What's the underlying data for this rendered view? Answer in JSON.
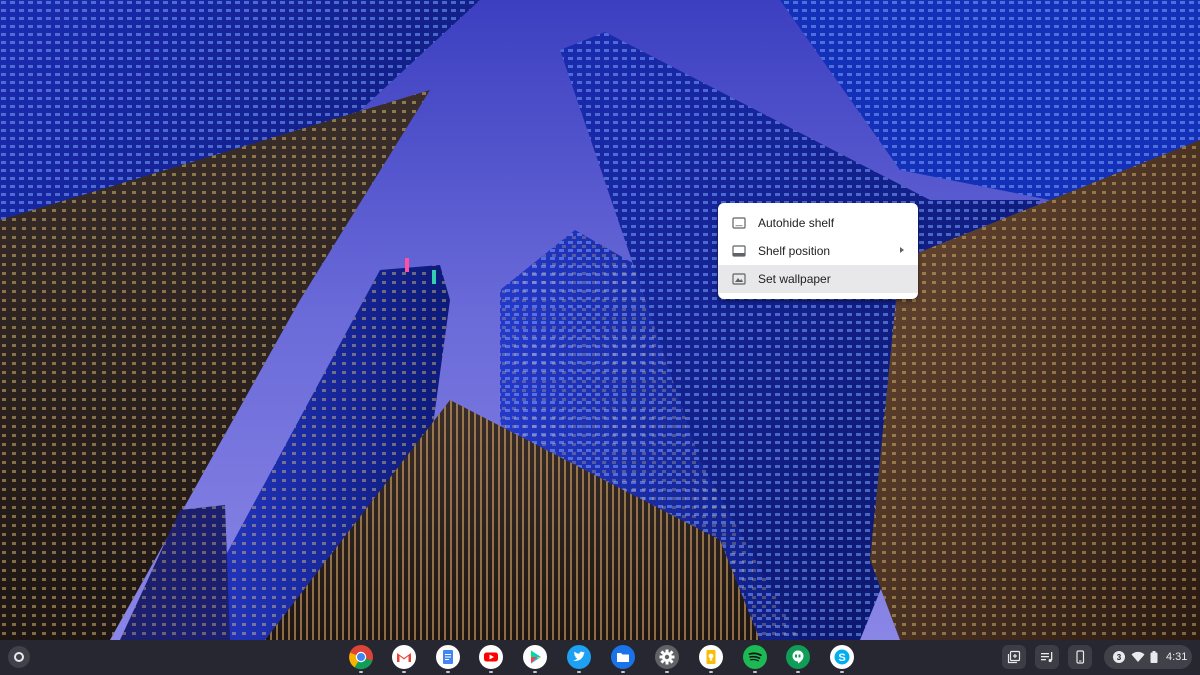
{
  "context_menu": {
    "items": [
      {
        "label": "Autohide shelf",
        "icon": "autohide-shelf-icon"
      },
      {
        "label": "Shelf position",
        "icon": "shelf-position-icon",
        "has_submenu": true
      },
      {
        "label": "Set wallpaper",
        "icon": "wallpaper-icon",
        "highlighted": true
      }
    ]
  },
  "shelf": {
    "launcher_icon": "launcher-icon",
    "apps": [
      {
        "name": "Chrome",
        "icon": "chrome-icon"
      },
      {
        "name": "Gmail",
        "icon": "gmail-icon"
      },
      {
        "name": "Google Docs",
        "icon": "docs-icon"
      },
      {
        "name": "YouTube",
        "icon": "youtube-icon"
      },
      {
        "name": "Play Store",
        "icon": "play-store-icon"
      },
      {
        "name": "Twitter",
        "icon": "twitter-icon"
      },
      {
        "name": "Files",
        "icon": "files-icon"
      },
      {
        "name": "Settings",
        "icon": "settings-icon"
      },
      {
        "name": "Google Keep",
        "icon": "keep-icon"
      },
      {
        "name": "Spotify",
        "icon": "spotify-icon"
      },
      {
        "name": "Google Hangouts",
        "icon": "hangouts-icon"
      },
      {
        "name": "Skype",
        "icon": "skype-icon"
      }
    ],
    "tray": {
      "notification_count": "3",
      "time": "4:31"
    }
  },
  "colors": {
    "shelf_background": "#26262c",
    "menu_background": "#ffffff",
    "menu_highlight": "#e8e8ea"
  }
}
